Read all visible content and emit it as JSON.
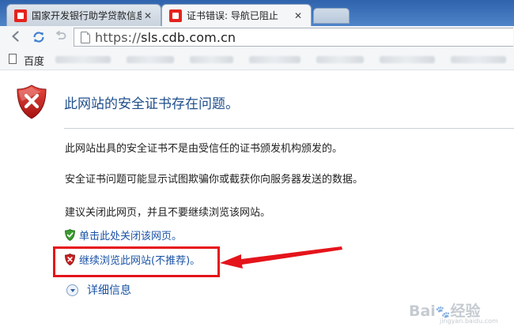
{
  "tabs": [
    {
      "title": "国家开发银行助学贷款信息",
      "active": false
    },
    {
      "title": "证书错误: 导航已阻止",
      "active": true
    }
  ],
  "toolbar": {
    "url_scheme": "https://",
    "url_host": "sls.cdb.com.cn",
    "back_icon": "back-arrow-icon",
    "refresh_icon": "refresh-icon",
    "undo_icon": "undo-icon"
  },
  "bookmarks": {
    "first_label": "百度"
  },
  "error_page": {
    "title": "此网站的安全证书存在问题。",
    "paragraphs": [
      "此网站出具的安全证书不是由受信任的证书颁发机构颁发的。",
      "安全证书问题可能显示试图欺骗你或截获你向服务器发送的数据。",
      "建议关闭此网页，并且不要继续浏览该网站。"
    ],
    "close_link": "单击此处关闭该网页。",
    "continue_link": "继续浏览此网站(不推荐)。",
    "details_link": "详细信息"
  },
  "colors": {
    "title_blue": "#1f4e8c",
    "link_blue": "#1a53a6",
    "annotation_red": "#e5141b",
    "shield_red": "#cc1f1f",
    "shield_green": "#3a9b2f"
  },
  "watermark": {
    "text": "Bai 经验",
    "sub": "jingyan.baidu.com"
  }
}
